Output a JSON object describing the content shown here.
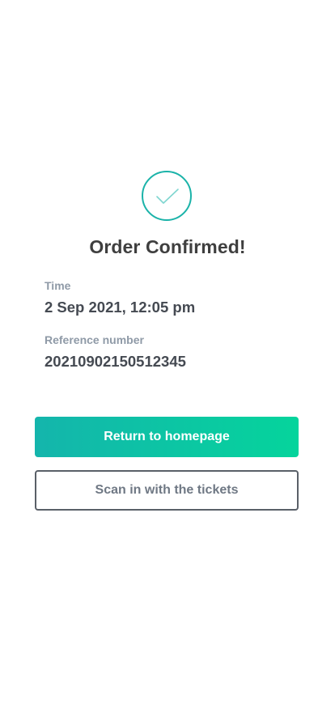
{
  "confirmation": {
    "icon": "check-circle-icon",
    "title": "Order Confirmed!"
  },
  "details": {
    "time_label": "Time",
    "time_value": "2 Sep 2021, 12:05 pm",
    "reference_label": "Reference number",
    "reference_value": "20210902150512345"
  },
  "actions": {
    "primary_label": "Return to homepage",
    "secondary_label": "Scan in with the tickets"
  },
  "colors": {
    "accent": "#1bb3a9",
    "gradient_start": "#14b5ac",
    "gradient_end": "#05d49c",
    "title_text": "#3f3f3f",
    "label_text": "#8f9aa7"
  }
}
